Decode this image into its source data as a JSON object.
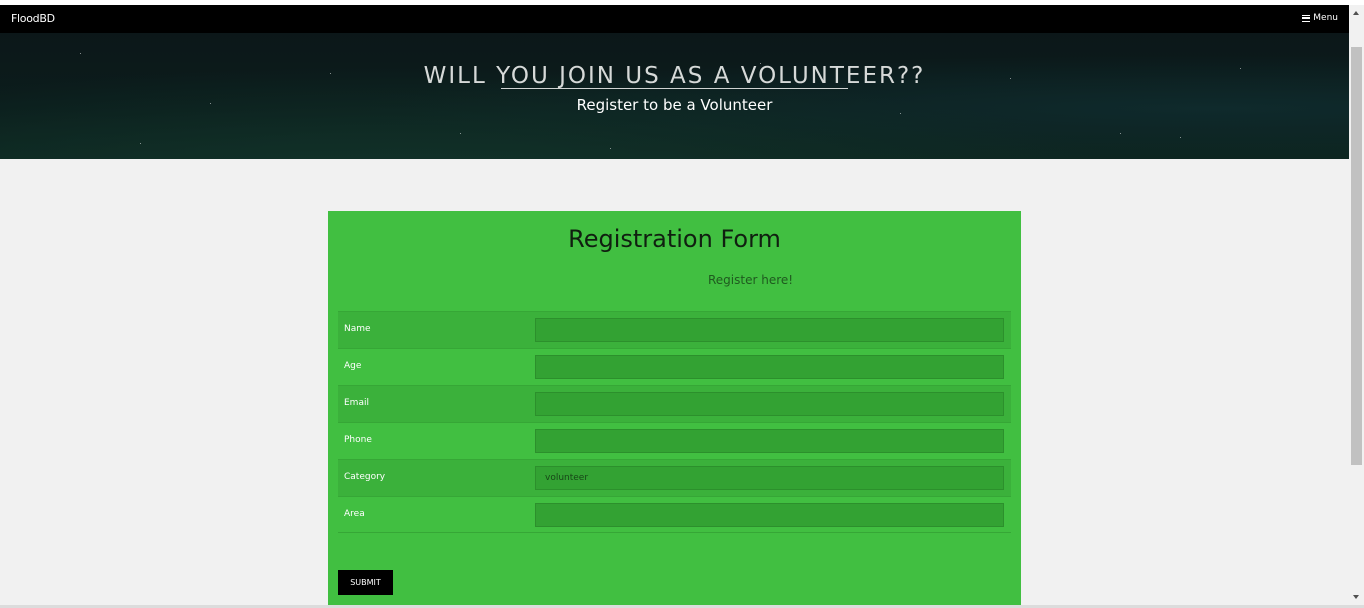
{
  "navbar": {
    "brand": "FloodBD",
    "menu_label": "Menu"
  },
  "hero": {
    "title": "WILL YOU JOIN US AS A VOLUNTEER??",
    "subtitle": "Register to be a Volunteer"
  },
  "form": {
    "title": "Registration Form",
    "subtitle": "Register here!",
    "fields": [
      {
        "label": "Name",
        "value": ""
      },
      {
        "label": "Age",
        "value": ""
      },
      {
        "label": "Email",
        "value": ""
      },
      {
        "label": "Phone",
        "value": ""
      },
      {
        "label": "Category",
        "value": "volunteer"
      },
      {
        "label": "Area",
        "value": ""
      }
    ],
    "submit_label": "SUBMIT"
  },
  "colors": {
    "navbar": "#000000",
    "panel": "#41bf41",
    "input": "#33a233",
    "page_bg": "#f1f1f1"
  },
  "icons": {
    "menu": "hamburger-icon",
    "scroll_up": "scroll-up-arrow",
    "scroll_down": "scroll-down-arrow"
  }
}
